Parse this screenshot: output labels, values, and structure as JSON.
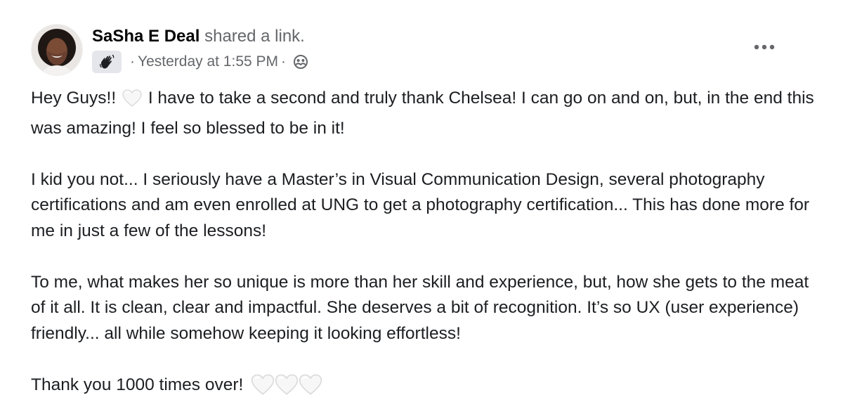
{
  "post": {
    "author": "SaSha E Deal",
    "action": "shared a link.",
    "separator": "·",
    "timestamp": "Yesterday at 1:55 PM",
    "paragraph1": {
      "before_heart": "Hey Guys!!",
      "after_heart": "I have to take a second and truly thank Chelsea! I can go on and on, but, in the end this was amazing! I feel so blessed to be in it!"
    },
    "paragraph2": "I kid you not... I seriously have a Master’s in Visual Communication Design, several photography certifications and am even enrolled at UNG to get a photography certification... This has done more for me in just a few of the lessons!",
    "paragraph3": "To me, what makes her so unique is more than her skill and experience, but, how she gets to the meat of it all. It is clean, clear and impactful. She deserves a bit of recognition. It’s so UX (user experience) friendly... all while somehow keeping it looking effortless!",
    "paragraph4": "Thank you 1000 times over!",
    "icons": {
      "group_badge": "waving-hand-icon",
      "audience": "members-audience-icon",
      "more": "more-options-icon",
      "emoji": "white-heart-emoji"
    },
    "colors": {
      "text": "#1c1e21",
      "secondary": "#65676b",
      "badge_bg": "#e4e6eb"
    }
  }
}
